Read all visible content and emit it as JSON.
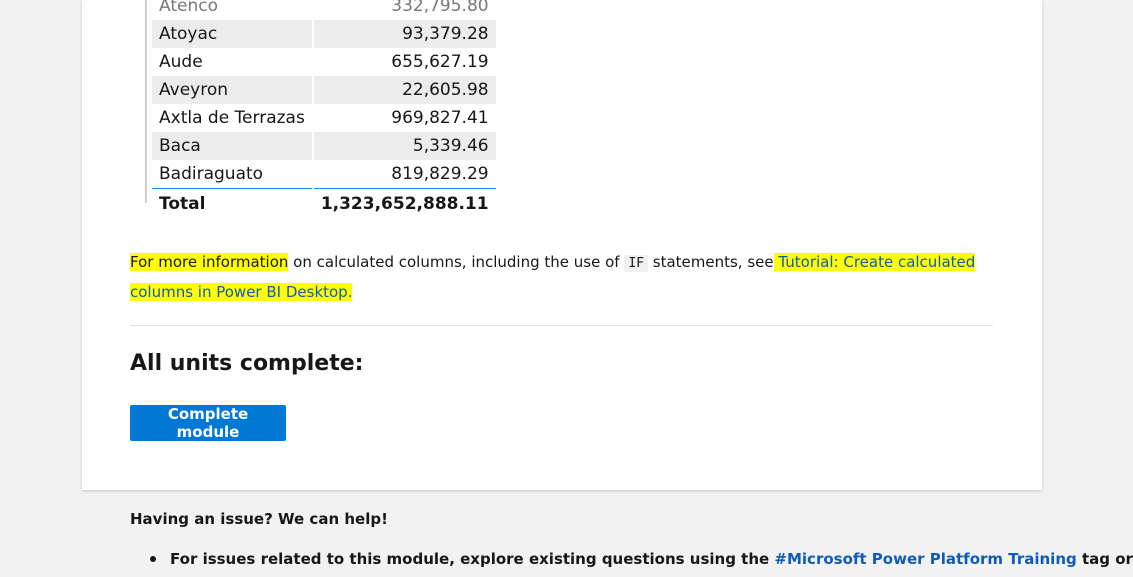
{
  "table": {
    "partial_row": {
      "name": "Atenco",
      "value": "332,795.80"
    },
    "rows": [
      {
        "name": "Atoyac",
        "value": "93,379.28"
      },
      {
        "name": "Aude",
        "value": "655,627.19"
      },
      {
        "name": "Aveyron",
        "value": "22,605.98"
      },
      {
        "name": "Axtla de Terrazas",
        "value": "969,827.41"
      },
      {
        "name": "Baca",
        "value": "5,339.46"
      },
      {
        "name": "Badiraguato",
        "value": "819,829.29"
      }
    ],
    "total": {
      "label": "Total",
      "value": "1,323,652,888.11"
    }
  },
  "info": {
    "highlight1": "For more information",
    "text1": " on calculated columns, including the use of ",
    "code": "IF",
    "text2": " statements, see",
    "link": " Tutorial: Create calculated columns in Power BI Desktop.",
    "highlight_color": "#ffff00"
  },
  "heading": "All units complete:",
  "complete_button": "Complete module",
  "help": {
    "title": "Having an issue? We can help!",
    "item_prefix": "For issues related to this module, explore existing questions using the ",
    "item_link": "#Microsoft Power Platform Training",
    "item_suffix": " tag or"
  },
  "colors": {
    "accent": "#0078d4",
    "link": "#0f5bb5"
  }
}
